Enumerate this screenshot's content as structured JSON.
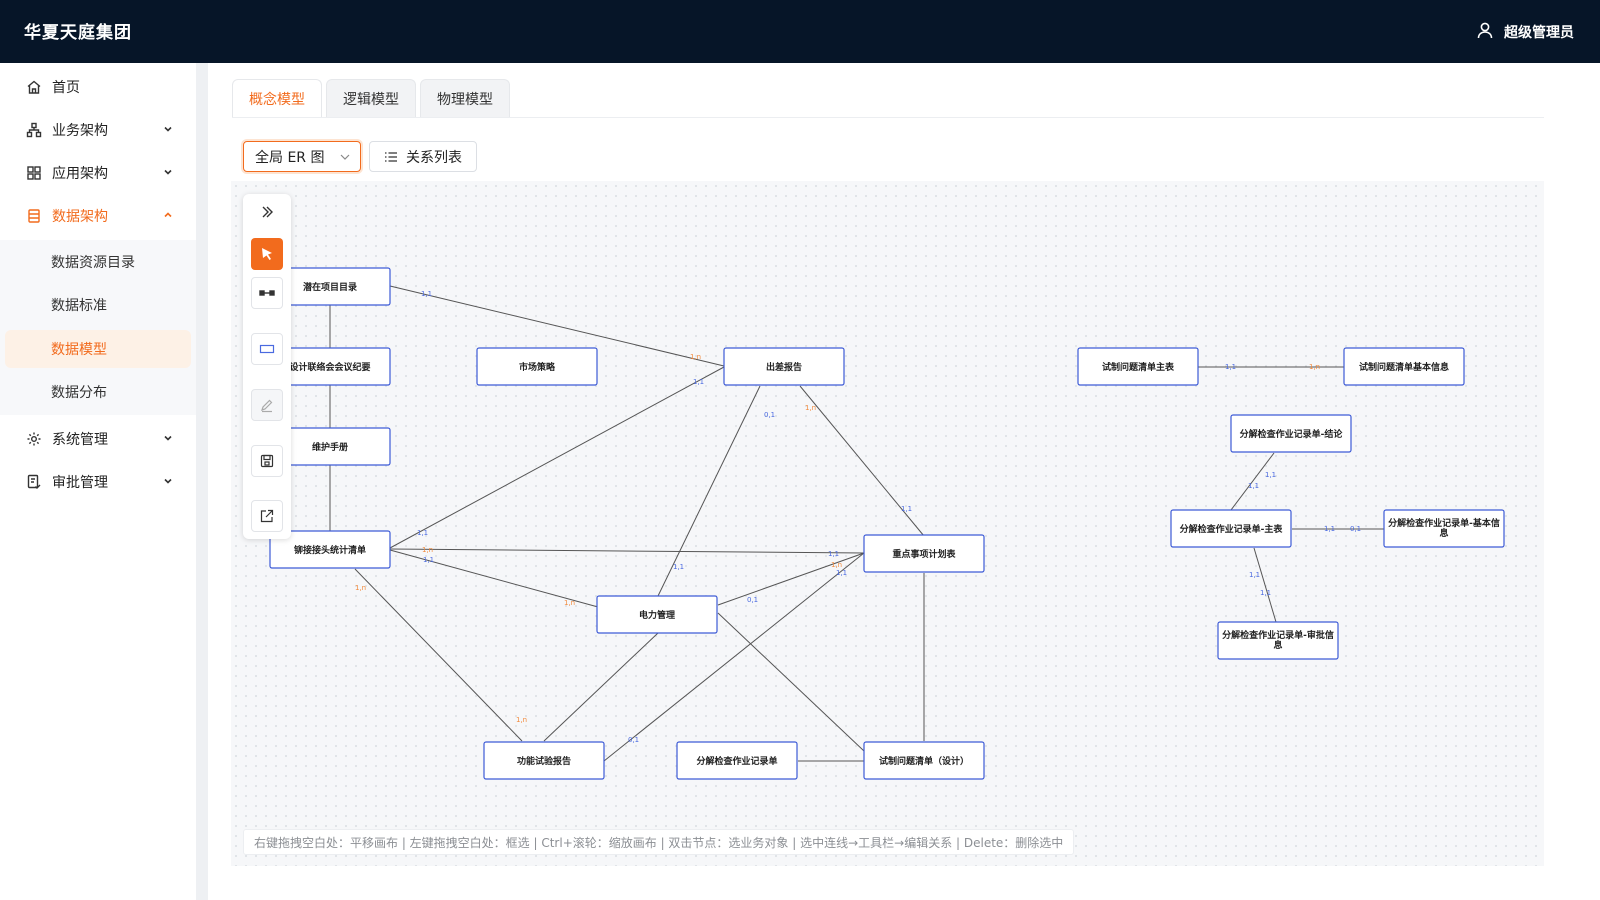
{
  "header": {
    "brand": "华夏天庭集团",
    "user_name": "超级管理员"
  },
  "sidebar": {
    "items": [
      {
        "label": "首页",
        "icon": "home-icon"
      },
      {
        "label": "业务架构",
        "icon": "sitemap-icon"
      },
      {
        "label": "应用架构",
        "icon": "grid-icon"
      },
      {
        "label": "数据架构",
        "icon": "database-icon",
        "active": true
      },
      {
        "label": "系统管理",
        "icon": "gear-icon"
      },
      {
        "label": "审批管理",
        "icon": "approval-icon"
      }
    ],
    "sub_items": [
      {
        "label": "数据资源目录"
      },
      {
        "label": "数据标准"
      },
      {
        "label": "数据模型",
        "active": true
      },
      {
        "label": "数据分布"
      }
    ]
  },
  "tabs": [
    {
      "label": "概念模型",
      "active": true
    },
    {
      "label": "逻辑模型"
    },
    {
      "label": "物理模型"
    }
  ],
  "toolbar": {
    "select_value": "全局 ER 图",
    "relation_list_label": "关系列表"
  },
  "entities": [
    {
      "id": "e1",
      "label": "潜在项目目录"
    },
    {
      "id": "e2",
      "label": "设计联络会会议纪要"
    },
    {
      "id": "e3",
      "label": "维护手册"
    },
    {
      "id": "e4",
      "label": "铆接接头统计清单"
    },
    {
      "id": "e5",
      "label": "市场策略"
    },
    {
      "id": "e6",
      "label": "出差报告"
    },
    {
      "id": "e7",
      "label": "电力管理"
    },
    {
      "id": "e8",
      "label": "重点事项计划表"
    },
    {
      "id": "e9",
      "label": "功能试验报告"
    },
    {
      "id": "e10",
      "label": "分解检查作业记录单"
    },
    {
      "id": "e11",
      "label": "试制问题清单（设计）"
    },
    {
      "id": "e12",
      "label": "试制问题清单主表"
    },
    {
      "id": "e13",
      "label": "试制问题清单基本信息"
    },
    {
      "id": "e14",
      "label": "分解检查作业记录单-结论"
    },
    {
      "id": "e15",
      "label": "分解检查作业记录单-主表"
    },
    {
      "id": "e16",
      "label": "分解检查作业记录单-基本信息"
    },
    {
      "id": "e17",
      "label": "分解检查作业记录单-审批信息"
    }
  ],
  "relations": [
    {
      "from": "e1",
      "to": "e6",
      "from_card": "1,1",
      "to_card": "1,n"
    },
    {
      "from": "e4",
      "to": "e6",
      "from_card": "1,1",
      "to_card": "1,1"
    },
    {
      "from": "e7",
      "to": "e6",
      "from_card": "1,1",
      "to_card": "0,1"
    },
    {
      "from": "e6",
      "to": "e8",
      "from_card": "1,n",
      "to_card": "1,1"
    },
    {
      "from": "e4",
      "to": "e8",
      "from_card": "1,n",
      "to_card": "1,1"
    },
    {
      "from": "e4",
      "to": "e7",
      "from_card": "1,1",
      "to_card": "1,n"
    },
    {
      "from": "e4",
      "to": "e9",
      "from_card": "1,n",
      "to_card": "1,n"
    },
    {
      "from": "e7",
      "to": "e8",
      "from_card": "0,1",
      "to_card": "1,n"
    },
    {
      "from": "e9",
      "to": "e8",
      "from_card": "0,1",
      "to_card": "1,1"
    },
    {
      "from": "e12",
      "to": "e13",
      "from_card": "1,1",
      "to_card": "1,n"
    },
    {
      "from": "e15",
      "to": "e14",
      "from_card": "1,1",
      "to_card": "1,1"
    },
    {
      "from": "e15",
      "to": "e16",
      "from_card": "1,1",
      "to_card": "0,1"
    },
    {
      "from": "e15",
      "to": "e17",
      "from_card": "1,1",
      "to_card": "1,1"
    }
  ],
  "hint": "右键拖拽空白处：平移画布 | 左键拖拽空白处：框选 | Ctrl+滚轮：缩放画布 | 双击节点：选业务对象 | 选中连线→工具栏→编辑关系 | Delete：删除选中",
  "colors": {
    "accent": "#f26b1d",
    "entity_border": "#3d5bd6",
    "card_one": "#f28a3c",
    "card_many": "#4a6ae0"
  }
}
